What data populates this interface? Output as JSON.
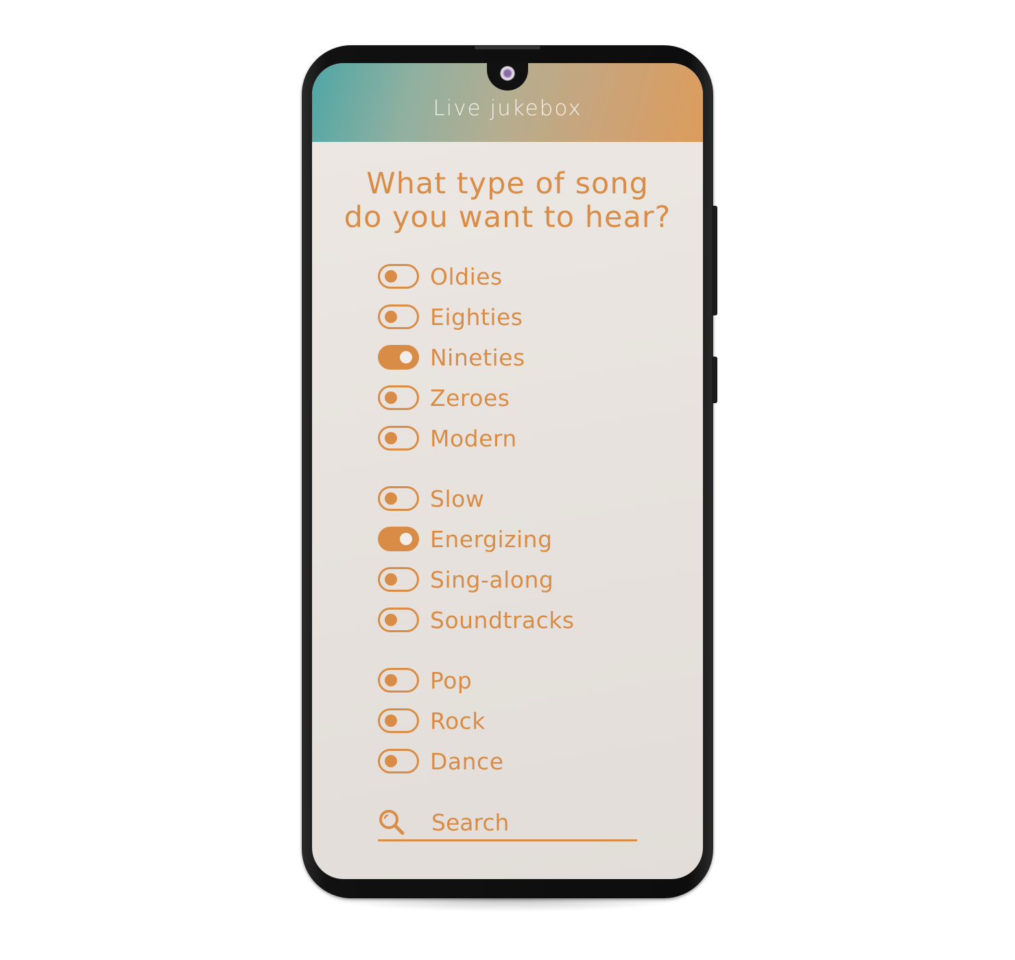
{
  "app": {
    "title": "Live jukebox"
  },
  "question": {
    "line1": "What type of song",
    "line2": "do you want to hear?"
  },
  "groups": [
    {
      "options": [
        {
          "label": "Oldies",
          "on": false
        },
        {
          "label": "Eighties",
          "on": false
        },
        {
          "label": "Nineties",
          "on": true
        },
        {
          "label": "Zeroes",
          "on": false
        },
        {
          "label": "Modern",
          "on": false
        }
      ]
    },
    {
      "options": [
        {
          "label": "Slow",
          "on": false
        },
        {
          "label": "Energizing",
          "on": true
        },
        {
          "label": "Sing-along",
          "on": false
        },
        {
          "label": "Soundtracks",
          "on": false
        }
      ]
    },
    {
      "options": [
        {
          "label": "Pop",
          "on": false
        },
        {
          "label": "Rock",
          "on": false
        },
        {
          "label": "Dance",
          "on": false
        }
      ]
    }
  ],
  "search": {
    "placeholder": "Search",
    "value": ""
  },
  "colors": {
    "accent": "#d98c45",
    "header_start": "#4fa6a6",
    "header_end": "#dc9c5c",
    "background": "#ebe6e1"
  }
}
